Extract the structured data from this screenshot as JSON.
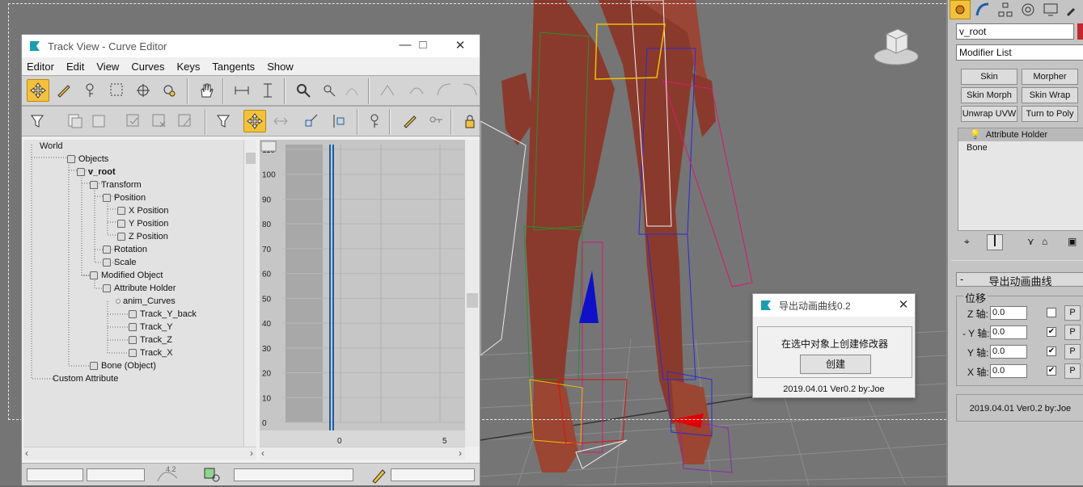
{
  "curve_editor": {
    "title": "Track View - Curve Editor",
    "menu": [
      "Editor",
      "Edit",
      "View",
      "Curves",
      "Keys",
      "Tangents",
      "Show"
    ],
    "tree": [
      {
        "label": "World",
        "bold": false
      },
      {
        "label": "Objects",
        "bold": false
      },
      {
        "label": "v_root",
        "bold": true
      },
      {
        "label": "Transform",
        "bold": false
      },
      {
        "label": "Position",
        "bold": false
      },
      {
        "label": "X Position",
        "bold": false
      },
      {
        "label": "Y Position",
        "bold": false
      },
      {
        "label": "Z Position",
        "bold": false
      },
      {
        "label": "Rotation",
        "bold": false
      },
      {
        "label": "Scale",
        "bold": false
      },
      {
        "label": "Modified Object",
        "bold": false
      },
      {
        "label": "Attribute Holder",
        "bold": false
      },
      {
        "label": "anim_Curves",
        "bold": false
      },
      {
        "label": "Track_Y_back",
        "bold": false
      },
      {
        "label": "Track_Y",
        "bold": false
      },
      {
        "label": "Track_Z",
        "bold": false
      },
      {
        "label": "Track_X",
        "bold": false
      },
      {
        "label": "Bone (Object)",
        "bold": false
      },
      {
        "label": "Custom Attribute",
        "bold": false
      }
    ],
    "y_ticks": [
      "110",
      "100",
      "90",
      "80",
      "70",
      "60",
      "50",
      "40",
      "30",
      "20",
      "10",
      "0"
    ],
    "x_ticks": [
      "0",
      "5"
    ],
    "status_value": "4.2"
  },
  "export_dialog": {
    "title": "导出动画曲线0.2",
    "label": "在选中对象上创建修改器",
    "create_button": "创建",
    "version": "2019.04.01 Ver0.2 by:Joe"
  },
  "command_panel": {
    "object_name": "v_root",
    "modifier_list": "Modifier List",
    "modifier_buttons": [
      "Skin",
      "Morpher",
      "Skin Morph",
      "Skin Wrap",
      "Unwrap UVW",
      "Turn to Poly"
    ],
    "stack": [
      "Attribute Holder",
      "Bone"
    ],
    "rollout_title": "导出动画曲线",
    "rollout_toggle": "-",
    "group_title": "位移",
    "axes": [
      {
        "label": "Z 轴:",
        "value": "0.0",
        "checked": false,
        "p": "P"
      },
      {
        "label": "- Y 轴:",
        "value": "0.0",
        "checked": true,
        "p": "P"
      },
      {
        "label": "Y 轴:",
        "value": "0.0",
        "checked": true,
        "p": "P"
      },
      {
        "label": "X 轴:",
        "value": "0.0",
        "checked": true,
        "p": "P"
      }
    ],
    "version": "2019.04.01 Ver0.2 by:Joe"
  },
  "colors": {
    "accent": "#f3c13b",
    "brand_teal": "#1a9db0",
    "axis_blue": "#1b5fa8"
  }
}
